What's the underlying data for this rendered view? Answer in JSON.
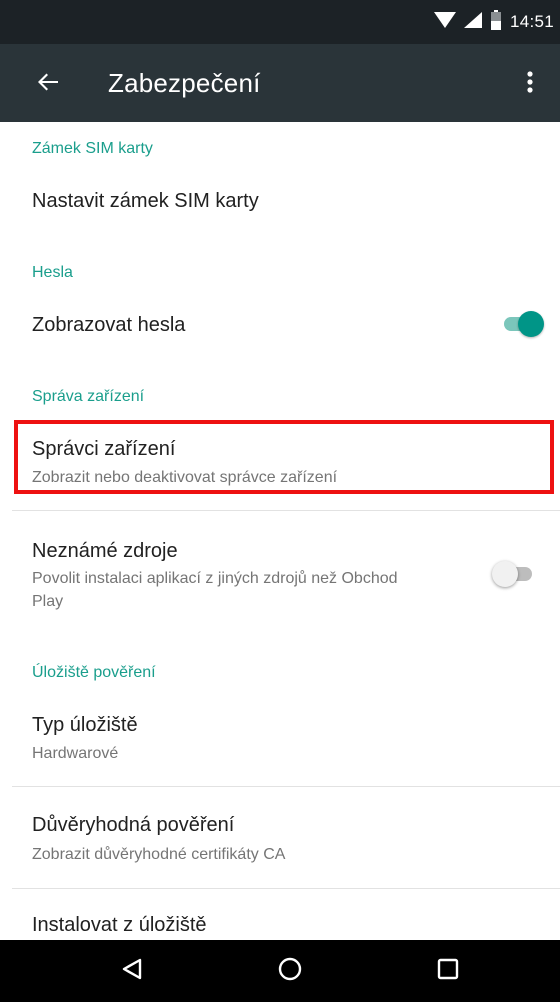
{
  "status_bar": {
    "time": "14:51",
    "icons": [
      "wifi-icon",
      "signal-icon",
      "battery-icon"
    ]
  },
  "app_bar": {
    "title": "Zabezpečení",
    "back_icon": "arrow-back-icon",
    "overflow_icon": "more-vert-icon"
  },
  "sections": {
    "sim": {
      "header": "Zámek SIM karty",
      "items": [
        {
          "title": "Nastavit zámek SIM karty"
        }
      ]
    },
    "passwords": {
      "header": "Hesla",
      "items": [
        {
          "title": "Zobrazovat hesla",
          "toggle": true
        }
      ]
    },
    "device_admin": {
      "header": "Správa zařízení",
      "items": [
        {
          "title": "Správci zařízení",
          "summary": "Zobrazit nebo deaktivovat správce zařízení",
          "highlighted": true
        },
        {
          "title": "Neznámé zdroje",
          "summary": "Povolit instalaci aplikací z jiných zdrojů než Obchod Play",
          "toggle": false
        }
      ]
    },
    "credentials": {
      "header": "Úložiště pověření",
      "items": [
        {
          "title": "Typ úložiště",
          "summary": "Hardwarové"
        },
        {
          "title": "Důvěryhodná pověření",
          "summary": "Zobrazit důvěryhodné certifikáty CA"
        },
        {
          "title": "Instalovat z úložiště"
        }
      ]
    }
  },
  "nav_bar": {
    "buttons": [
      "back-triangle-icon",
      "home-circle-icon",
      "recents-square-icon"
    ]
  },
  "colors": {
    "accent": "#009587",
    "section_header": "#1a9e8c",
    "app_bar": "#2a3439",
    "status_bar": "#1c2226",
    "highlight": "#ee1111"
  }
}
